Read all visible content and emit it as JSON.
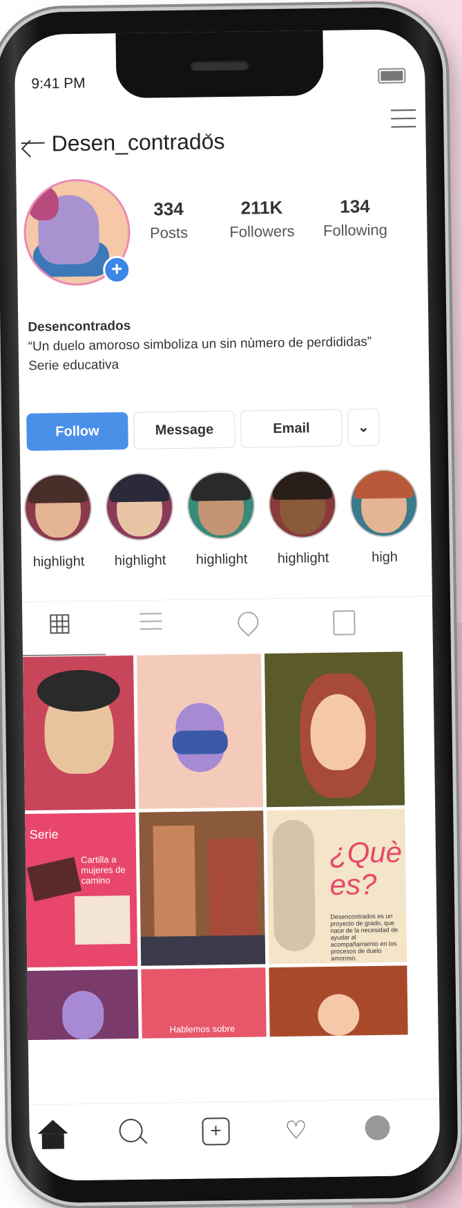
{
  "status_bar": {
    "time": "9:41 PM"
  },
  "header": {
    "username": "Desen_contrados",
    "caret": "⌄"
  },
  "profile": {
    "avatar_badge": "+",
    "stats": [
      {
        "num": "334",
        "label": "Posts"
      },
      {
        "num": "211K",
        "label": "Followers"
      },
      {
        "num": "134",
        "label": "Following"
      }
    ]
  },
  "bio": {
    "name": "Desencontrados",
    "quote": "“Un duelo amoroso simboliza un sin nùmero de perdididas”",
    "desc": "Serie educativa"
  },
  "actions": {
    "follow": "Follow",
    "message": "Message",
    "email": "Email",
    "more": "⌄"
  },
  "highlights": [
    {
      "label": "highlight"
    },
    {
      "label": "highlight"
    },
    {
      "label": "highlight"
    },
    {
      "label": "highlight"
    },
    {
      "label": "high"
    }
  ],
  "posts": {
    "serie_text": "Serie",
    "cartilla_text": "Cartilla a mujeres de camino",
    "que_text": "¿Què es?",
    "desc_text": "Desencontrados es un proyecto de grado, que nace de la necesidad de ayudar al acompañamiento en los procesos de duelo amoroso.",
    "hablemos_text": "Hablemos sobre"
  },
  "colors": {
    "accent": "#4a90e8",
    "avatar_ring": "#e98ab6"
  }
}
